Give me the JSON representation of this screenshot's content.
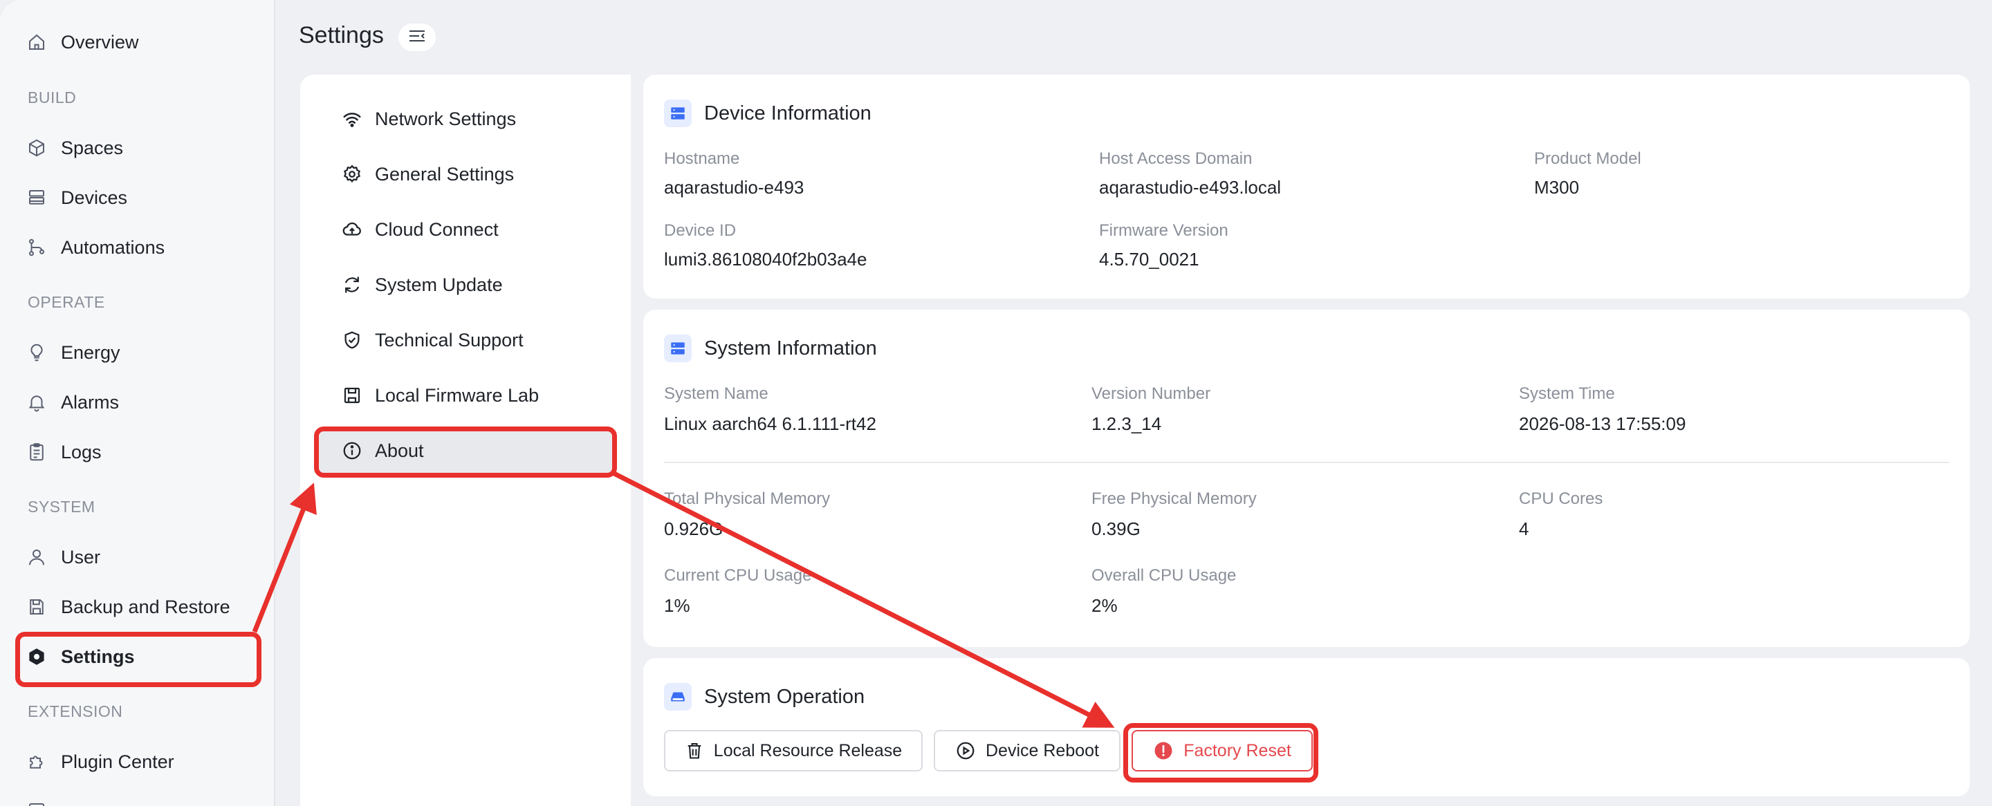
{
  "page": {
    "title": "Settings"
  },
  "sidebar": {
    "overview": "Overview",
    "sections": {
      "build": "BUILD",
      "operate": "OPERATE",
      "system": "SYSTEM",
      "extension": "EXTENSION"
    },
    "items": {
      "spaces": "Spaces",
      "devices": "Devices",
      "automations": "Automations",
      "energy": "Energy",
      "alarms": "Alarms",
      "logs": "Logs",
      "user": "User",
      "backup": "Backup and Restore",
      "settings": "Settings",
      "plugin_center": "Plugin Center"
    },
    "active": "Settings"
  },
  "submenu": {
    "items": [
      {
        "label": "Network Settings",
        "icon": "wifi-icon"
      },
      {
        "label": "General Settings",
        "icon": "gear-icon"
      },
      {
        "label": "Cloud Connect",
        "icon": "cloud-icon"
      },
      {
        "label": "System Update",
        "icon": "refresh-icon"
      },
      {
        "label": "Technical Support",
        "icon": "shield-check-icon"
      },
      {
        "label": "Local Firmware Lab",
        "icon": "save-icon"
      },
      {
        "label": "About",
        "icon": "info-icon"
      }
    ],
    "active": "About"
  },
  "device_info": {
    "title": "Device Information",
    "hostname_label": "Hostname",
    "hostname": "aqarastudio-e493",
    "host_domain_label": "Host Access Domain",
    "host_domain": "aqarastudio-e493.local",
    "product_model_label": "Product Model",
    "product_model": "M300",
    "device_id_label": "Device ID",
    "device_id": "lumi3.86108040f2b03a4e",
    "firmware_label": "Firmware Version",
    "firmware": "4.5.70_0021"
  },
  "system_info": {
    "title": "System Information",
    "system_name_label": "System Name",
    "system_name": "Linux aarch64 6.1.111-rt42",
    "version_label": "Version Number",
    "version": "1.2.3_14",
    "time_label": "System Time",
    "time": "2026-08-13 17:55:09",
    "total_mem_label": "Total Physical Memory",
    "total_mem": "0.926G",
    "free_mem_label": "Free Physical Memory",
    "free_mem": "0.39G",
    "cpu_cores_label": "CPU Cores",
    "cpu_cores": "4",
    "current_cpu_label": "Current CPU Usage",
    "current_cpu": "1%",
    "overall_cpu_label": "Overall CPU Usage",
    "overall_cpu": "2%"
  },
  "system_operation": {
    "title": "System Operation",
    "release_label": "Local Resource Release",
    "reboot_label": "Device Reboot",
    "factory_reset_label": "Factory Reset"
  },
  "colors": {
    "accent": "#3b6ef5",
    "danger": "#e5484d",
    "annotation": "#e8302c"
  }
}
